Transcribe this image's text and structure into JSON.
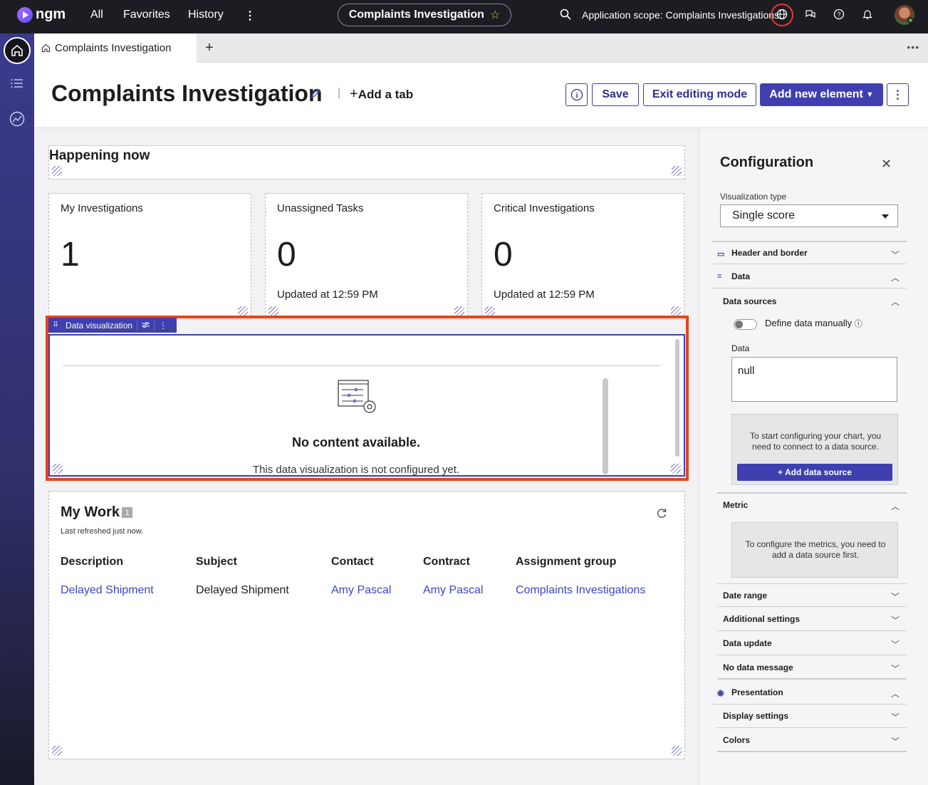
{
  "topbar": {
    "logo_text": "ngm",
    "nav": [
      "All",
      "Favorites",
      "History"
    ],
    "pill_title": "Complaints Investigation",
    "scope": "Application scope: Complaints Investigations"
  },
  "tab": {
    "label": "Complaints Investigation"
  },
  "header": {
    "title": "Complaints Investigation",
    "add_tab": "Add a tab",
    "info_label": "i",
    "save": "Save",
    "exit": "Exit editing mode",
    "add_element": "Add new element"
  },
  "happening": {
    "title": "Happening now"
  },
  "scores": [
    {
      "label": "My Investigations",
      "value": "1",
      "updated": ""
    },
    {
      "label": "Unassigned Tasks",
      "value": "0",
      "updated": "Updated at 12:59 PM"
    },
    {
      "label": "Critical Investigations",
      "value": "0",
      "updated": "Updated at 12:59 PM"
    }
  ],
  "dataviz": {
    "handle_label": "Data visualization",
    "no_content": "No content available.",
    "sub": "This data visualization is not configured yet."
  },
  "mywork": {
    "title": "My Work",
    "count": "1",
    "refreshed": "Last refreshed just now.",
    "columns": [
      "Description",
      "Subject",
      "Contact",
      "Contract",
      "Assignment group"
    ],
    "row": [
      "Delayed Shipment",
      "Delayed Shipment",
      "Amy Pascal",
      "Amy Pascal",
      "Complaints Investigations"
    ]
  },
  "config": {
    "title": "Configuration",
    "viz_type_label": "Visualization type",
    "viz_type_value": "Single score",
    "sections": {
      "header_border": "Header and border",
      "data": "Data",
      "data_sources": "Data sources",
      "metric": "Metric",
      "date_range": "Date range",
      "additional": "Additional settings",
      "data_update": "Data update",
      "no_data": "No data message",
      "presentation": "Presentation",
      "display": "Display settings",
      "colors": "Colors"
    },
    "define_manually": "Define data manually",
    "data_label": "Data",
    "data_value": "null",
    "connect_text": "To start configuring your chart, you need to connect to a data source.",
    "add_data_source": "Add data source",
    "metric_text": "To configure the metrics, you need to add a data source first."
  },
  "colors": {
    "accent": "#3f3fb0",
    "selection": "#e8441b",
    "link": "#3b46c4"
  }
}
